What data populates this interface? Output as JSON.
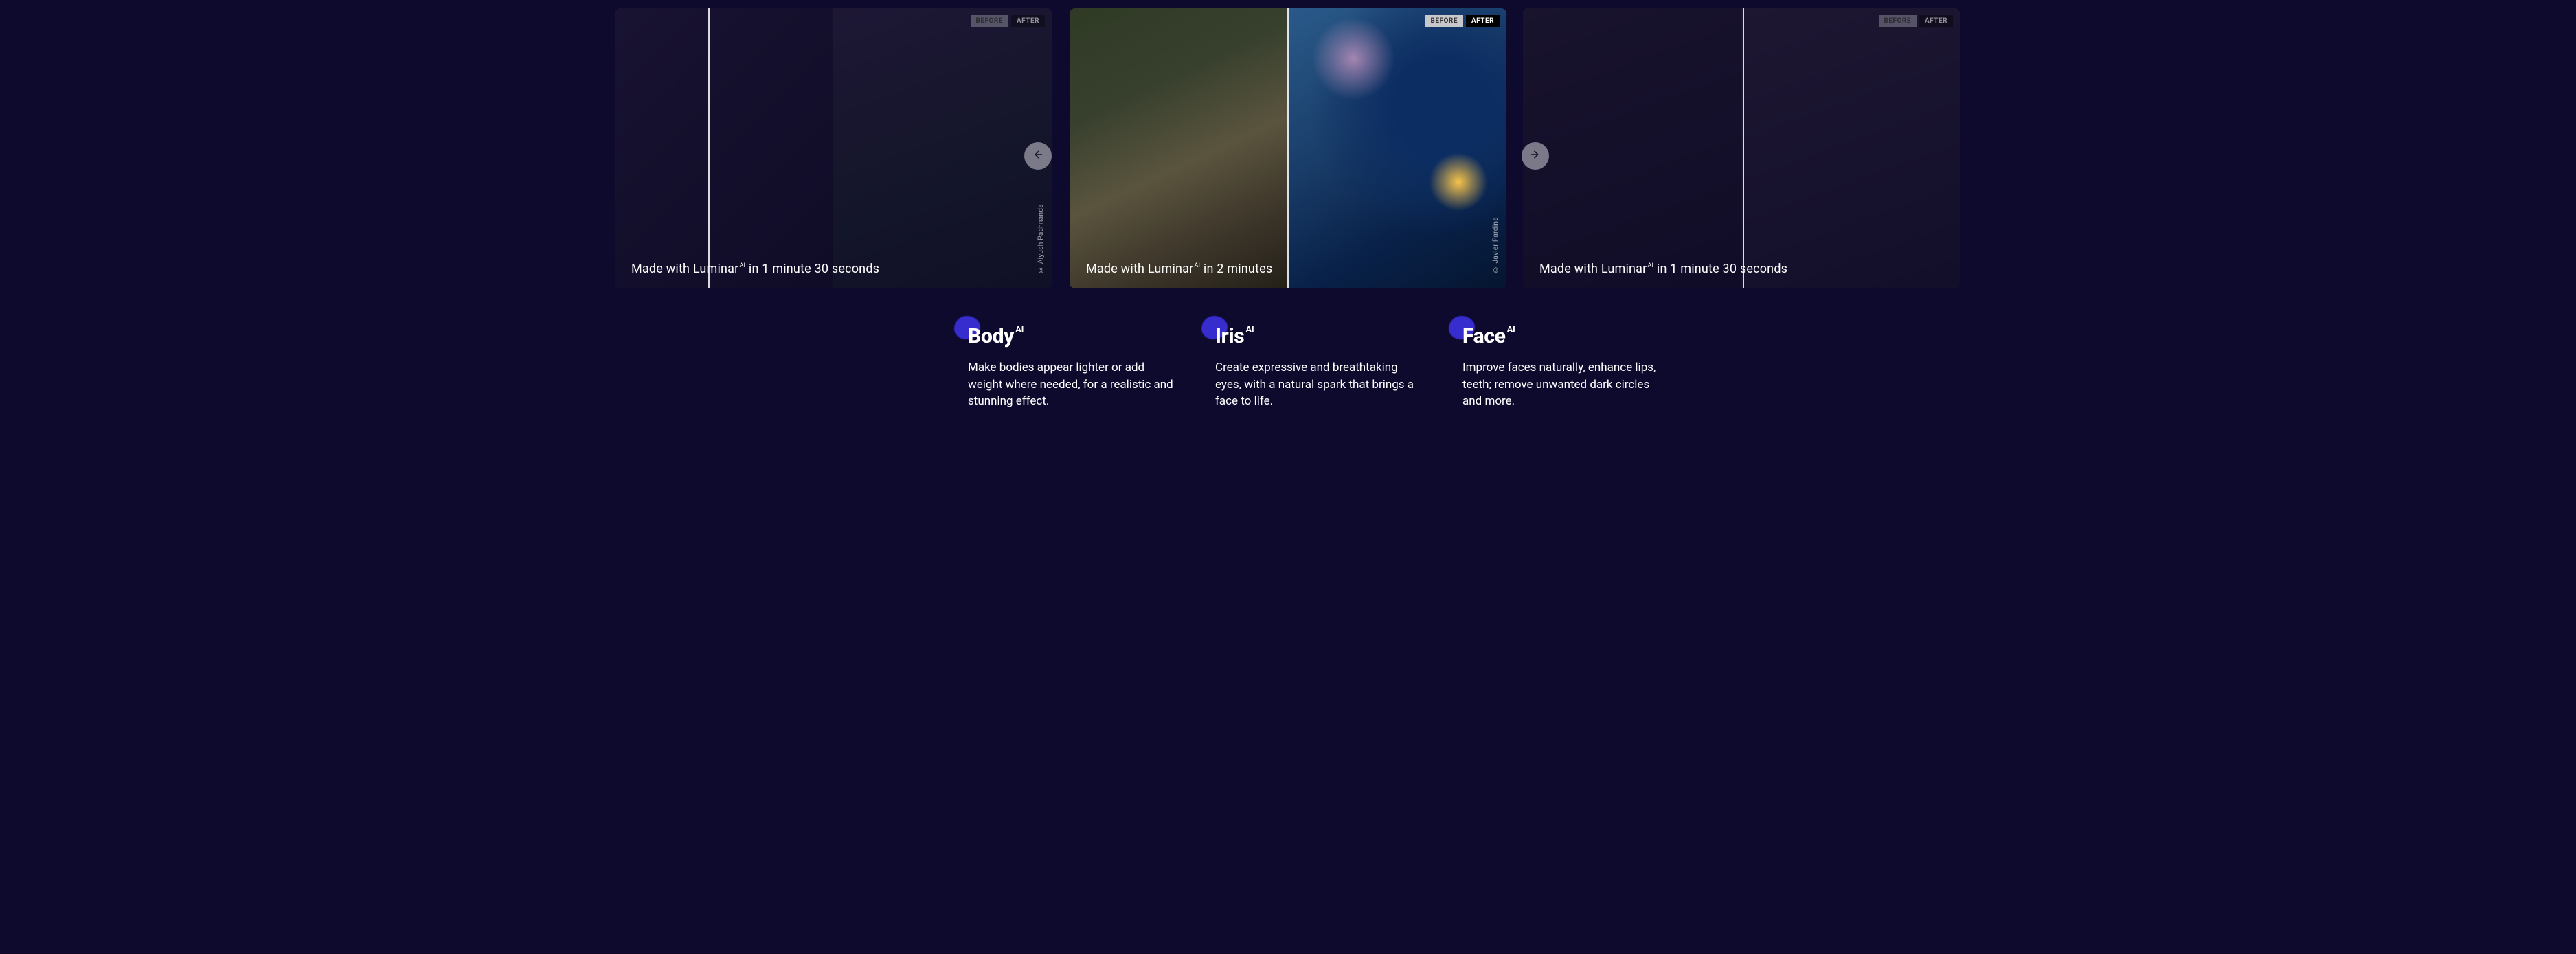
{
  "labels": {
    "before": "BEFORE",
    "after": "AFTER"
  },
  "cards": [
    {
      "caption_prefix": "Made with Luminar",
      "caption_sup": "AI",
      "caption_suffix": " in 1 minute 30 seconds",
      "credit": "© Aiyush Pachnanda"
    },
    {
      "caption_prefix": "Made with Luminar",
      "caption_sup": "AI",
      "caption_suffix": " in 2 minutes",
      "credit": "© Javier Pardina"
    },
    {
      "caption_prefix": "Made with Luminar",
      "caption_sup": "AI",
      "caption_suffix": " in 1 minute 30 seconds",
      "credit": ""
    }
  ],
  "features": [
    {
      "title": "Body",
      "title_sup": "AI",
      "desc": "Make bodies appear lighter or add weight where needed, for a realistic and stunning effect."
    },
    {
      "title": "Iris",
      "title_sup": "AI",
      "desc": "Create expressive and breathtaking eyes, with a natural spark that brings a face to life."
    },
    {
      "title": "Face",
      "title_sup": "AI",
      "desc": "Improve faces naturally, enhance lips, teeth; remove unwanted dark circles and more."
    }
  ]
}
